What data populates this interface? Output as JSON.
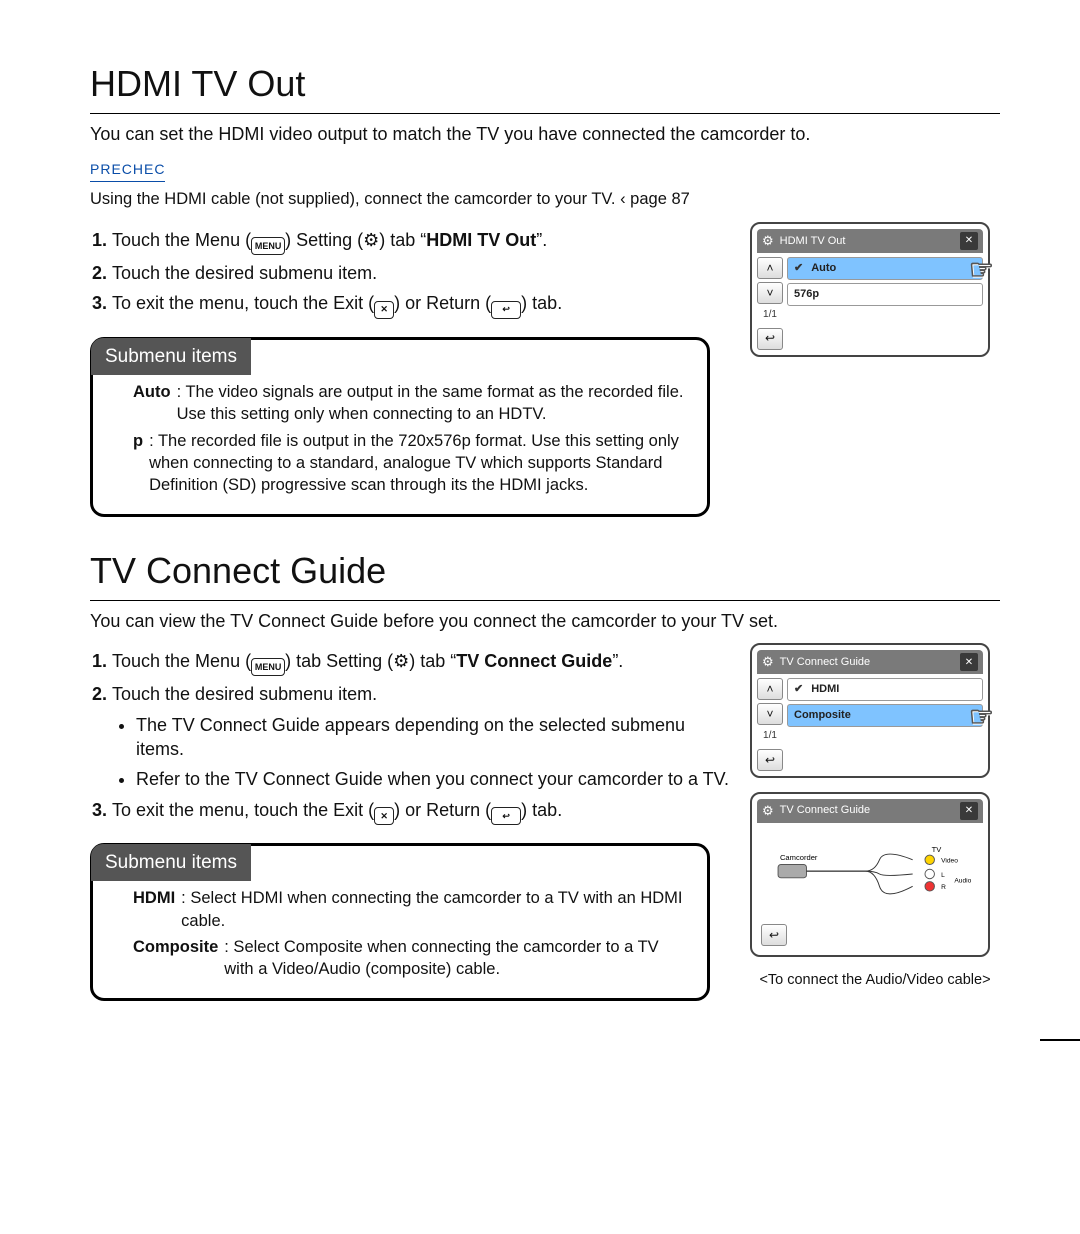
{
  "sections": {
    "hdmi": {
      "title": "HDMI TV Out",
      "intro": "You can set the HDMI video output to match the TV you have connected the camcorder to.",
      "prechec": "PRECHEC",
      "prechec_note": "Using the HDMI cable (not supplied), connect the camcorder to your TV.  ‹ page 87",
      "steps": {
        "s1_a": "Touch the Menu (",
        "s1_b": ")     Setting (",
        "s1_c": ") tab     “",
        "s1_d": "HDMI TV Out",
        "s1_e": "”.",
        "s2": "Touch the desired submenu item.",
        "s3_a": "To exit the menu, touch the Exit (",
        "s3_b": ") or Return (",
        "s3_c": ") tab."
      },
      "submenu_title": "Submenu items",
      "submenu": {
        "auto_term": "Auto",
        "auto_desc": ": The video signals are output in the same format as the recorded file. Use this setting only when connecting to an HDTV.",
        "p_term": "p",
        "p_desc": ": The recorded file is output in the 720x576p format. Use this setting only when connecting to a standard, analogue TV which supports Standard Definition (SD) progressive scan through its the HDMI jacks."
      },
      "lcd": {
        "title": "HDMI TV Out",
        "page": "1/1",
        "row1": "Auto",
        "row2": "576p"
      }
    },
    "tvc": {
      "title": "TV Connect Guide",
      "intro": "You can view the TV Connect Guide before you connect the camcorder to your TV set.",
      "steps": {
        "s1_a": "Touch the Menu (",
        "s1_b": ") tab     Setting (",
        "s1_c": ") tab     “",
        "s1_d": "TV Connect Guide",
        "s1_e": "”.",
        "s2_head": "Touch the desired submenu item.",
        "s2_bullets": [
          "The TV Connect Guide appears depending on the selected submenu items.",
          "Refer to the TV Connect Guide when you connect your camcorder to a TV."
        ],
        "s3_a": "To exit the menu, touch the Exit (",
        "s3_b": ") or Return (",
        "s3_c": ") tab."
      },
      "submenu_title": "Submenu items",
      "submenu": {
        "hdmi_term": "HDMI",
        "hdmi_desc": ": Select HDMI when connecting the camcorder to a TV with an HDMI cable.",
        "comp_term": "Composite",
        "comp_desc": ":  Select Composite when connecting the camcorder to a TV with a Video/Audio (composite) cable."
      },
      "lcd1": {
        "title": "TV Connect Guide",
        "page": "1/1",
        "row1": "HDMI",
        "row2": "Composite"
      },
      "lcd2": {
        "title": "TV Connect Guide",
        "diag": {
          "left": "Camcorder",
          "right": "TV",
          "video": "Video",
          "l": "L",
          "r": "R",
          "audio": "Audio"
        }
      },
      "caption": "<To connect the Audio/Video cable>"
    }
  },
  "icons": {
    "menu": "MENU",
    "exit": "✕",
    "return": "↩",
    "gear": "⚙",
    "up": "˄",
    "down": "˅"
  }
}
